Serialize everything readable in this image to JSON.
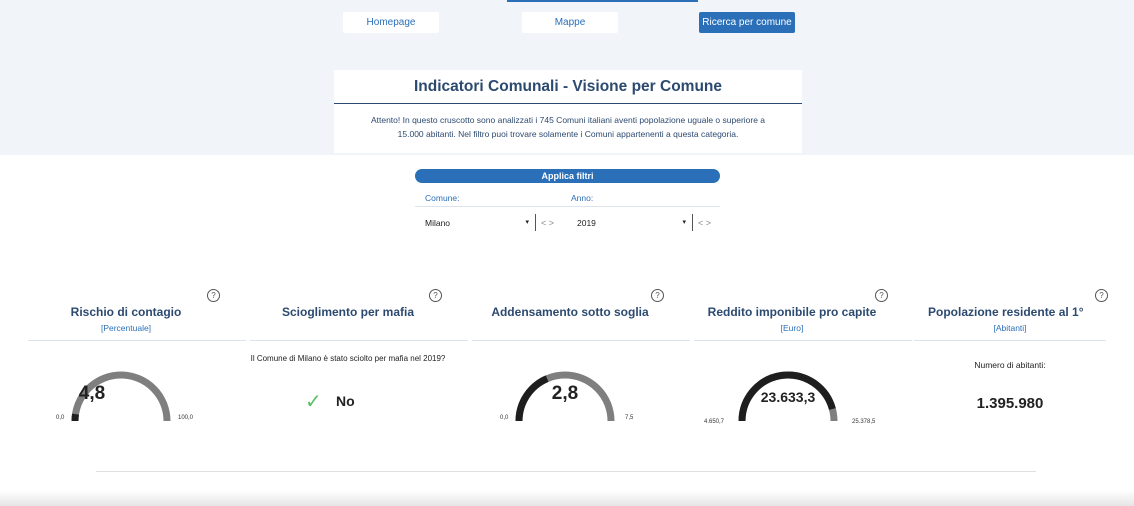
{
  "nav": {
    "homepage": "Homepage",
    "mappe": "Mappe",
    "ricerca": "Ricerca per comune"
  },
  "header": {
    "title": "Indicatori Comunali - Visione per Comune",
    "desc_line1": "Attento! In questo cruscotto sono analizzati i 745 Comuni italiani aventi popolazione uguale o superiore a",
    "desc_line2": "15.000 abitanti. Nel filtro puoi trovare solamente i Comuni appartenenti a questa categoria."
  },
  "filters": {
    "apply_label": "Applica filtri",
    "comune_label": "Comune:",
    "anno_label": "Anno:",
    "comune_value": "Milano",
    "anno_value": "2019",
    "nav_glyph": "< >",
    "caret": "▾"
  },
  "cards": {
    "rischio": {
      "title": "Rischio di contagio",
      "unit": "[Percentuale]",
      "value": "4,8",
      "min": "0,0",
      "max": "100,0",
      "fill": 0.048
    },
    "mafia": {
      "title": "Scioglimento per mafia",
      "question": "Il Comune di Milano è stato sciolto per mafia nel 2019?",
      "answer": "No"
    },
    "addensamento": {
      "title": "Addensamento sotto soglia",
      "value": "2,8",
      "min": "0,0",
      "max": "7,5",
      "fill": 0.373
    },
    "reddito": {
      "title": "Reddito imponibile pro capite",
      "unit": "[Euro]",
      "value": "23.633,3",
      "min": "4.650,7",
      "max": "25.378,5",
      "fill": 0.916
    },
    "popolazione": {
      "title": "Popolazione residente al 1°",
      "unit": "[Abitanti]",
      "label": "Numero di abitanti:",
      "value": "1.395.980"
    }
  },
  "help_glyph": "?",
  "colors": {
    "accent": "#2a6fb8",
    "title": "#2c4a70",
    "gauge_fill": "#1e1e1e",
    "gauge_track": "#7f7f7f",
    "check": "#5cbf67"
  }
}
